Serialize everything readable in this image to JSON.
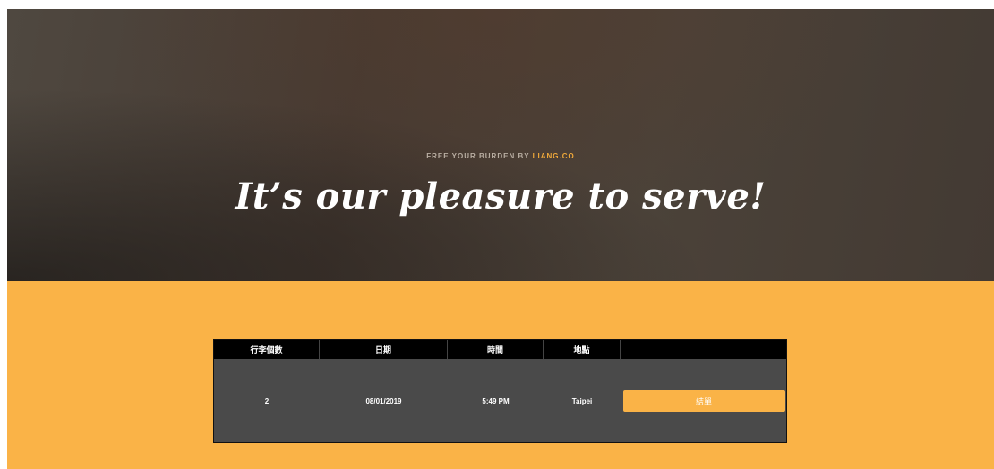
{
  "hero": {
    "subtitle_prefix": "FREE YOUR BURDEN BY ",
    "subtitle_brand": "LIANG.CO",
    "title": "It’s our pleasure to serve!"
  },
  "order_table": {
    "headers": [
      "行李個數",
      "日期",
      "時間",
      "地點",
      ""
    ],
    "row": {
      "luggage_count": "2",
      "date": "08/01/2019",
      "time": "5:49 PM",
      "location": "Taipei",
      "checkout_label": "結單"
    }
  },
  "colors": {
    "accent": "#fab347",
    "brand_text": "#f0a93a",
    "table_body": "#4a4a4a",
    "table_header": "#000000"
  }
}
